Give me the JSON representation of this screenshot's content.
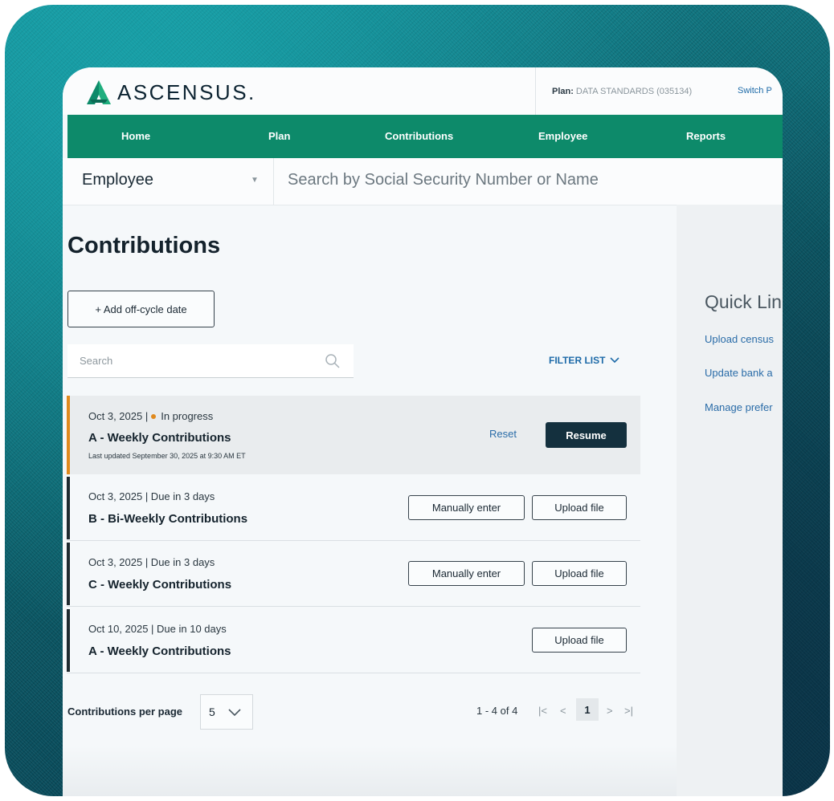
{
  "app": {
    "logo_text": "ASCENSUS.",
    "plan_label": "Plan:",
    "plan_value": "DATA STANDARDS (035134)",
    "switch_text": "Switch P"
  },
  "nav": {
    "items": [
      "Home",
      "Plan",
      "Contributions",
      "Employee",
      "Reports"
    ]
  },
  "search_bar": {
    "category": "Employee",
    "placeholder": "Search by Social Security Number or Name"
  },
  "main": {
    "title": "Contributions",
    "add_button": "+ Add off-cycle date",
    "search_placeholder": "Search",
    "filter_label": "FILTER LIST"
  },
  "rows": [
    {
      "meta_date": "Oct 3, 2025 |",
      "meta_status": "In progress",
      "title": "A - Weekly Contributions",
      "subtext": "Last updated September 30, 2025 at 9:30 AM ET",
      "reset_label": "Reset",
      "resume_label": "Resume"
    },
    {
      "meta": "Oct 3, 2025 | Due in 3 days",
      "title": "B - Bi-Weekly Contributions",
      "manual_label": "Manually enter",
      "upload_label": "Upload file"
    },
    {
      "meta": "Oct 3, 2025 | Due in 3 days",
      "title": "C - Weekly Contributions",
      "manual_label": "Manually enter",
      "upload_label": "Upload file"
    },
    {
      "meta": "Oct 10, 2025 | Due in 10 days",
      "title": "A - Weekly Contributions",
      "upload_label": "Upload file"
    }
  ],
  "pagination": {
    "per_page_label": "Contributions per page",
    "per_page_value": "5",
    "range": "1 - 4 of 4",
    "current_page": "1",
    "first": "|<",
    "prev": "<",
    "next": ">",
    "last": ">|"
  },
  "quick_links": {
    "title": "Quick Lin",
    "links": [
      "Upload census",
      "Update bank a",
      "Manage prefer"
    ]
  },
  "colors": {
    "nav_green": "#0d8a6a",
    "in_progress_orange": "#e08a1e",
    "resume_dark": "#14303e",
    "link_blue": "#2a6ca8"
  }
}
